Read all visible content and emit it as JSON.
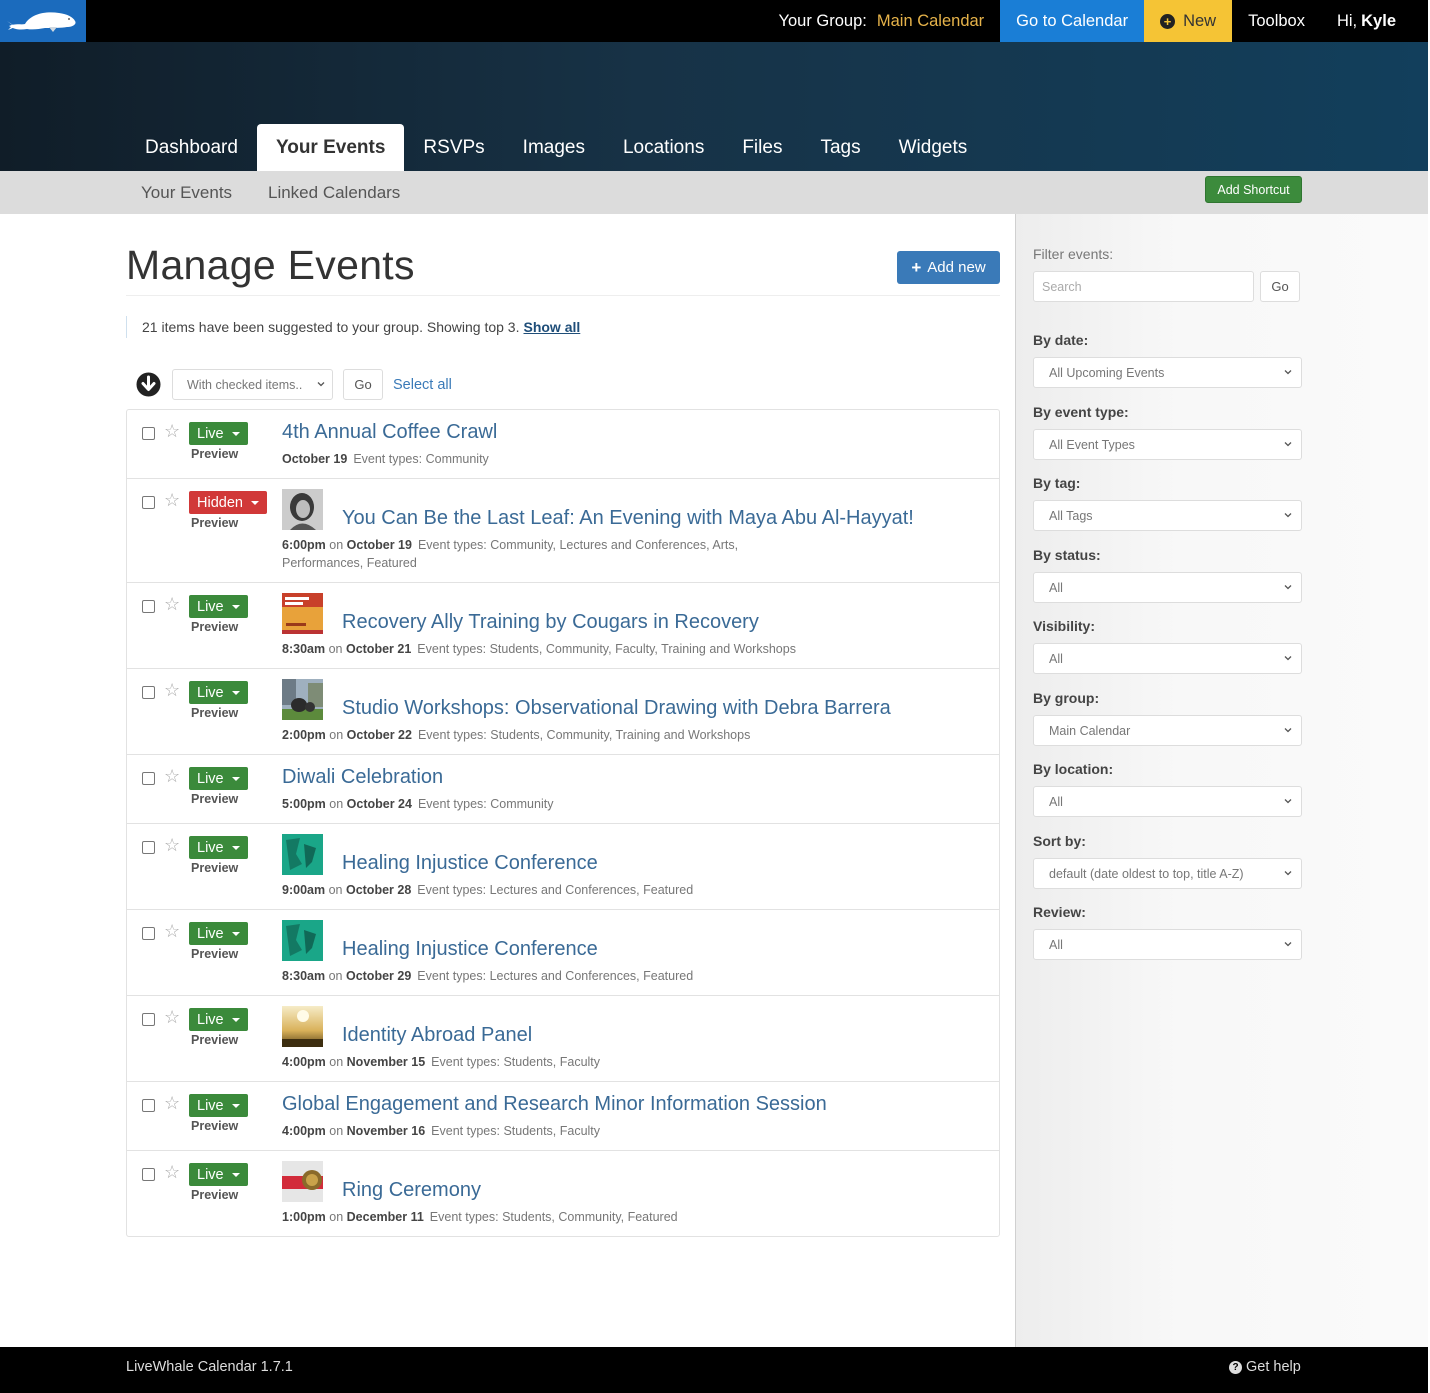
{
  "topbar": {
    "logo_icon": "whale-logo-icon",
    "group_label": "Your Group:",
    "group_value": "Main Calendar",
    "go_to_calendar": "Go to Calendar",
    "new_label": "New",
    "toolbox": "Toolbox",
    "greeting": "Hi,",
    "user_name": "Kyle",
    "colors": {
      "goto_bg": "#1a7ed6",
      "new_bg": "#f5c435",
      "group_value": "#e6b34a",
      "logo_bg": "#1b6bbd"
    }
  },
  "tabs": [
    {
      "label": "Dashboard",
      "active": false
    },
    {
      "label": "Your Events",
      "active": true
    },
    {
      "label": "RSVPs",
      "active": false
    },
    {
      "label": "Images",
      "active": false
    },
    {
      "label": "Locations",
      "active": false
    },
    {
      "label": "Files",
      "active": false
    },
    {
      "label": "Tags",
      "active": false
    },
    {
      "label": "Widgets",
      "active": false
    }
  ],
  "subnav": {
    "items": [
      "Your Events",
      "Linked Calendars"
    ],
    "add_shortcut": "Add Shortcut"
  },
  "main": {
    "title": "Manage Events",
    "add_new": "Add new",
    "notice": "21 items have been suggested to your group. Showing top 3.",
    "show_all": "Show all",
    "bulk": {
      "with_checked": "With checked items..",
      "go": "Go",
      "select_all": "Select all"
    }
  },
  "events": [
    {
      "status": "Live",
      "preview": "Preview",
      "title": "4th Annual Coffee Crawl",
      "time": "",
      "date": "October 19",
      "types_label": "Event types:",
      "types": "Community",
      "thumb": null
    },
    {
      "status": "Hidden",
      "preview": "Preview",
      "title": "You Can Be the Last Leaf: An Evening with Maya Abu Al-Hayyat!",
      "time": "6:00pm",
      "date": "October 19",
      "types_label": "Event types:",
      "types": "Community, Lectures and Conferences, Arts, Performances, Featured",
      "thumb": "portrait"
    },
    {
      "status": "Live",
      "preview": "Preview",
      "title": "Recovery Ally Training by Cougars in Recovery",
      "time": "8:30am",
      "date": "October 21",
      "types_label": "Event types:",
      "types": "Students, Community, Faculty, Training and Workshops",
      "thumb": "poster"
    },
    {
      "status": "Live",
      "preview": "Preview",
      "title": "Studio Workshops: Observational Drawing with Debra Barrera",
      "time": "2:00pm",
      "date": "October 22",
      "types_label": "Event types:",
      "types": "Students, Community, Training and Workshops",
      "thumb": "sculpture"
    },
    {
      "status": "Live",
      "preview": "Preview",
      "title": "Diwali Celebration",
      "time": "5:00pm",
      "date": "October 24",
      "types_label": "Event types:",
      "types": "Community",
      "thumb": null
    },
    {
      "status": "Live",
      "preview": "Preview",
      "title": "Healing Injustice Conference",
      "time": "9:00am",
      "date": "October 28",
      "types_label": "Event types:",
      "types": "Lectures and Conferences, Featured",
      "thumb": "teal"
    },
    {
      "status": "Live",
      "preview": "Preview",
      "title": "Healing Injustice Conference",
      "time": "8:30am",
      "date": "October 29",
      "types_label": "Event types:",
      "types": "Lectures and Conferences, Featured",
      "thumb": "teal"
    },
    {
      "status": "Live",
      "preview": "Preview",
      "title": "Identity Abroad Panel",
      "time": "4:00pm",
      "date": "November 15",
      "types_label": "Event types:",
      "types": "Students, Faculty",
      "thumb": "sunset"
    },
    {
      "status": "Live",
      "preview": "Preview",
      "title": "Global Engagement and Research Minor Information Session",
      "time": "4:00pm",
      "date": "November 16",
      "types_label": "Event types:",
      "types": "Students, Faculty",
      "thumb": null
    },
    {
      "status": "Live",
      "preview": "Preview",
      "title": "Ring Ceremony",
      "time": "1:00pm",
      "date": "December 11",
      "types_label": "Event types:",
      "types": "Students, Community, Featured",
      "thumb": "ring"
    }
  ],
  "on_word": "on",
  "sidebar": {
    "filter_label": "Filter events:",
    "search_placeholder": "Search",
    "go": "Go",
    "filters": [
      {
        "label": "By date:",
        "value": "All Upcoming Events"
      },
      {
        "label": "By event type:",
        "value": "All Event Types"
      },
      {
        "label": "By tag:",
        "value": "All Tags"
      },
      {
        "label": "By status:",
        "value": "All"
      },
      {
        "label": "Visibility:",
        "value": "All"
      },
      {
        "label": "By group:",
        "value": "Main Calendar"
      },
      {
        "label": "By location:",
        "value": "All"
      },
      {
        "label": "Sort by:",
        "value": "default (date oldest to top, title A-Z)"
      },
      {
        "label": "Review:",
        "value": "All"
      }
    ]
  },
  "footer": {
    "version": "LiveWhale Calendar 1.7.1",
    "help": "Get help"
  }
}
